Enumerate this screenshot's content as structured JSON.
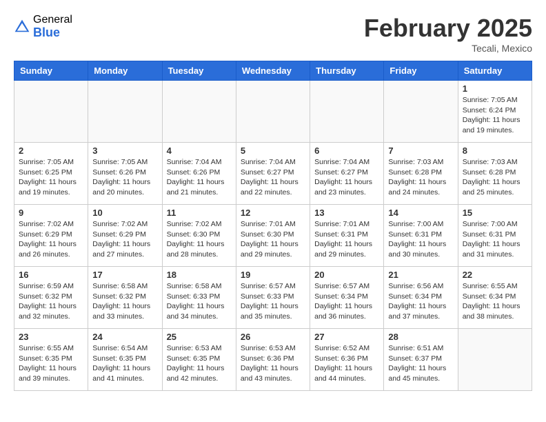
{
  "header": {
    "logo_general": "General",
    "logo_blue": "Blue",
    "month_title": "February 2025",
    "location": "Tecali, Mexico"
  },
  "weekdays": [
    "Sunday",
    "Monday",
    "Tuesday",
    "Wednesday",
    "Thursday",
    "Friday",
    "Saturday"
  ],
  "weeks": [
    [
      {
        "day": "",
        "info": ""
      },
      {
        "day": "",
        "info": ""
      },
      {
        "day": "",
        "info": ""
      },
      {
        "day": "",
        "info": ""
      },
      {
        "day": "",
        "info": ""
      },
      {
        "day": "",
        "info": ""
      },
      {
        "day": "1",
        "info": "Sunrise: 7:05 AM\nSunset: 6:24 PM\nDaylight: 11 hours\nand 19 minutes."
      }
    ],
    [
      {
        "day": "2",
        "info": "Sunrise: 7:05 AM\nSunset: 6:25 PM\nDaylight: 11 hours\nand 19 minutes."
      },
      {
        "day": "3",
        "info": "Sunrise: 7:05 AM\nSunset: 6:26 PM\nDaylight: 11 hours\nand 20 minutes."
      },
      {
        "day": "4",
        "info": "Sunrise: 7:04 AM\nSunset: 6:26 PM\nDaylight: 11 hours\nand 21 minutes."
      },
      {
        "day": "5",
        "info": "Sunrise: 7:04 AM\nSunset: 6:27 PM\nDaylight: 11 hours\nand 22 minutes."
      },
      {
        "day": "6",
        "info": "Sunrise: 7:04 AM\nSunset: 6:27 PM\nDaylight: 11 hours\nand 23 minutes."
      },
      {
        "day": "7",
        "info": "Sunrise: 7:03 AM\nSunset: 6:28 PM\nDaylight: 11 hours\nand 24 minutes."
      },
      {
        "day": "8",
        "info": "Sunrise: 7:03 AM\nSunset: 6:28 PM\nDaylight: 11 hours\nand 25 minutes."
      }
    ],
    [
      {
        "day": "9",
        "info": "Sunrise: 7:02 AM\nSunset: 6:29 PM\nDaylight: 11 hours\nand 26 minutes."
      },
      {
        "day": "10",
        "info": "Sunrise: 7:02 AM\nSunset: 6:29 PM\nDaylight: 11 hours\nand 27 minutes."
      },
      {
        "day": "11",
        "info": "Sunrise: 7:02 AM\nSunset: 6:30 PM\nDaylight: 11 hours\nand 28 minutes."
      },
      {
        "day": "12",
        "info": "Sunrise: 7:01 AM\nSunset: 6:30 PM\nDaylight: 11 hours\nand 29 minutes."
      },
      {
        "day": "13",
        "info": "Sunrise: 7:01 AM\nSunset: 6:31 PM\nDaylight: 11 hours\nand 29 minutes."
      },
      {
        "day": "14",
        "info": "Sunrise: 7:00 AM\nSunset: 6:31 PM\nDaylight: 11 hours\nand 30 minutes."
      },
      {
        "day": "15",
        "info": "Sunrise: 7:00 AM\nSunset: 6:31 PM\nDaylight: 11 hours\nand 31 minutes."
      }
    ],
    [
      {
        "day": "16",
        "info": "Sunrise: 6:59 AM\nSunset: 6:32 PM\nDaylight: 11 hours\nand 32 minutes."
      },
      {
        "day": "17",
        "info": "Sunrise: 6:58 AM\nSunset: 6:32 PM\nDaylight: 11 hours\nand 33 minutes."
      },
      {
        "day": "18",
        "info": "Sunrise: 6:58 AM\nSunset: 6:33 PM\nDaylight: 11 hours\nand 34 minutes."
      },
      {
        "day": "19",
        "info": "Sunrise: 6:57 AM\nSunset: 6:33 PM\nDaylight: 11 hours\nand 35 minutes."
      },
      {
        "day": "20",
        "info": "Sunrise: 6:57 AM\nSunset: 6:34 PM\nDaylight: 11 hours\nand 36 minutes."
      },
      {
        "day": "21",
        "info": "Sunrise: 6:56 AM\nSunset: 6:34 PM\nDaylight: 11 hours\nand 37 minutes."
      },
      {
        "day": "22",
        "info": "Sunrise: 6:55 AM\nSunset: 6:34 PM\nDaylight: 11 hours\nand 38 minutes."
      }
    ],
    [
      {
        "day": "23",
        "info": "Sunrise: 6:55 AM\nSunset: 6:35 PM\nDaylight: 11 hours\nand 39 minutes."
      },
      {
        "day": "24",
        "info": "Sunrise: 6:54 AM\nSunset: 6:35 PM\nDaylight: 11 hours\nand 41 minutes."
      },
      {
        "day": "25",
        "info": "Sunrise: 6:53 AM\nSunset: 6:35 PM\nDaylight: 11 hours\nand 42 minutes."
      },
      {
        "day": "26",
        "info": "Sunrise: 6:53 AM\nSunset: 6:36 PM\nDaylight: 11 hours\nand 43 minutes."
      },
      {
        "day": "27",
        "info": "Sunrise: 6:52 AM\nSunset: 6:36 PM\nDaylight: 11 hours\nand 44 minutes."
      },
      {
        "day": "28",
        "info": "Sunrise: 6:51 AM\nSunset: 6:37 PM\nDaylight: 11 hours\nand 45 minutes."
      },
      {
        "day": "",
        "info": ""
      }
    ]
  ]
}
